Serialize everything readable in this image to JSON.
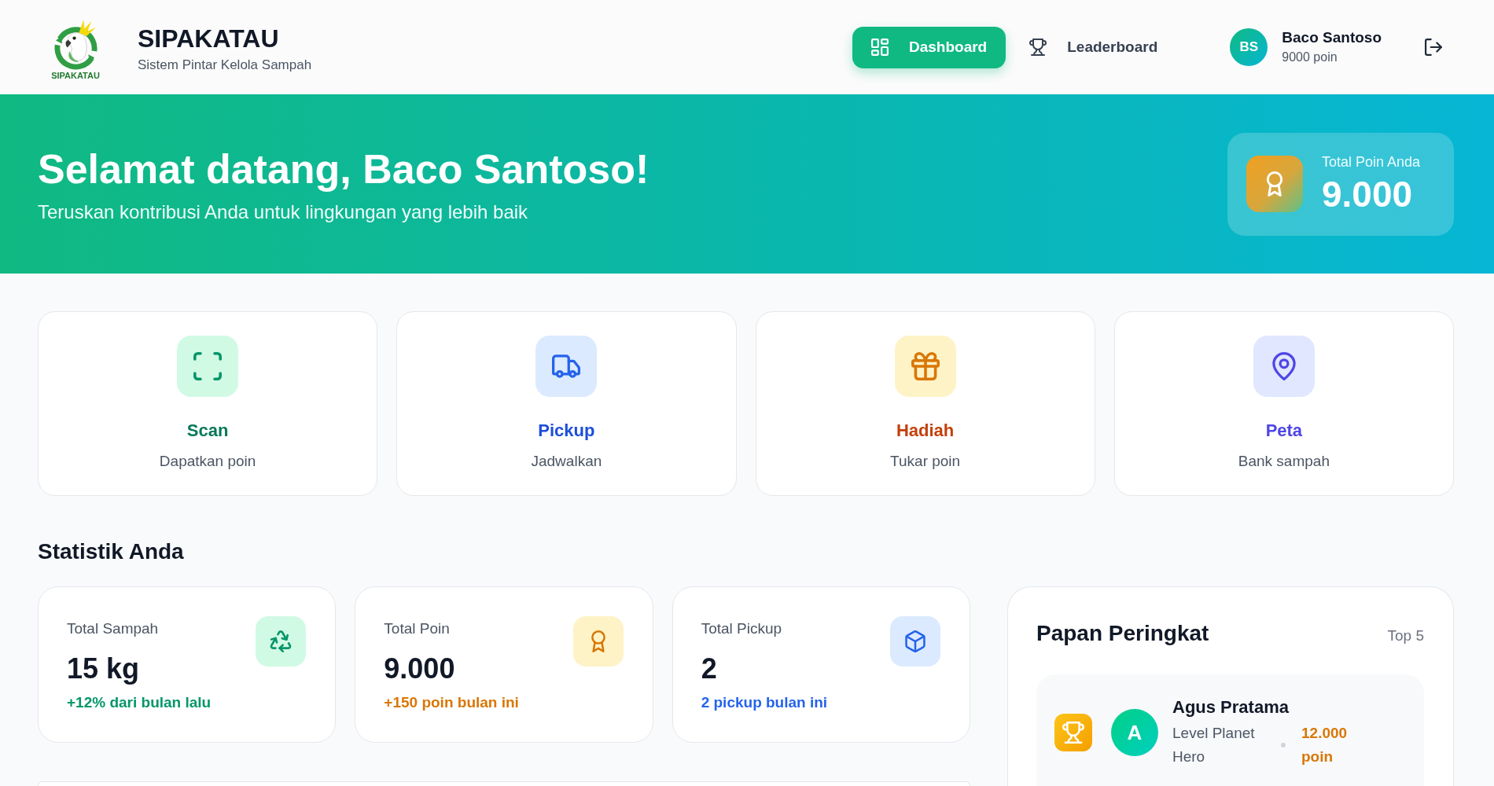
{
  "header": {
    "logo_text": "SIPAKATAU",
    "title": "SIPAKATAU",
    "subtitle": "Sistem Pintar Kelola Sampah",
    "nav": [
      {
        "kind": "dashboard",
        "label": "Dashboard",
        "selected": true
      },
      {
        "kind": "leaderboard",
        "label": "Leaderboard",
        "selected": false
      }
    ],
    "user": {
      "initials": "BS",
      "name": "Baco Santoso",
      "points": "9000 poin"
    }
  },
  "hero": {
    "title": "Selamat datang, Baco Santoso!",
    "subtitle": "Teruskan kontribusi Anda untuk lingkungan yang lebih baik",
    "points_card": {
      "label": "Total Poin Anda",
      "value": "9.000"
    }
  },
  "quick_actions": [
    {
      "kind": "scan",
      "title": "Scan",
      "subtitle": "Dapatkan poin"
    },
    {
      "kind": "pickup",
      "title": "Pickup",
      "subtitle": "Jadwalkan"
    },
    {
      "kind": "reward",
      "title": "Hadiah",
      "subtitle": "Tukar poin"
    },
    {
      "kind": "map",
      "title": "Peta",
      "subtitle": "Bank sampah"
    }
  ],
  "stats": {
    "title": "Statistik Anda",
    "cards": [
      {
        "kind": "waste",
        "label": "Total Sampah",
        "value": "15 kg",
        "note": "+12% dari bulan lalu"
      },
      {
        "kind": "points",
        "label": "Total Poin",
        "value": "9.000",
        "note": "+150 poin bulan ini"
      },
      {
        "kind": "pickup",
        "label": "Total Pickup",
        "value": "2",
        "note": "2 pickup bulan ini"
      }
    ]
  },
  "leaderboard": {
    "title": "Papan Peringkat",
    "badge": "Top 5",
    "entries": [
      {
        "initial": "A",
        "name": "Agus Pratama",
        "level": "Level Planet Hero",
        "points": "12.000 poin"
      }
    ]
  }
}
